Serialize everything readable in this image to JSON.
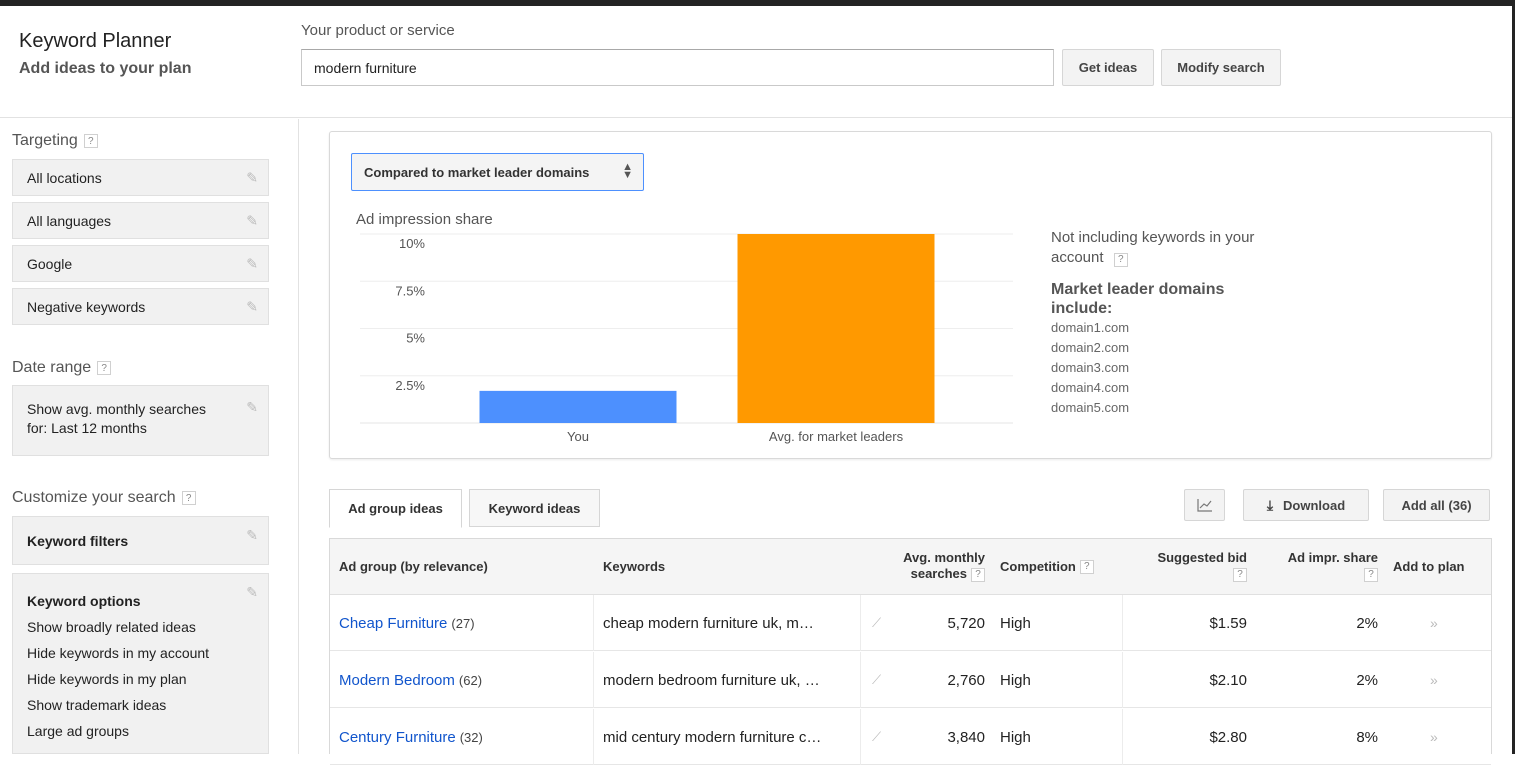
{
  "app": {
    "title": "Keyword Planner",
    "subtitle": "Add ideas to your plan"
  },
  "search": {
    "label": "Your product or service",
    "value": "modern furniture",
    "get_ideas": "Get ideas",
    "modify_search": "Modify search"
  },
  "sidebar": {
    "targeting_label": "Targeting",
    "targeting_items": [
      {
        "label": "All locations"
      },
      {
        "label": "All languages"
      },
      {
        "label": "Google"
      },
      {
        "label": "Negative keywords"
      }
    ],
    "date_range_label": "Date range",
    "date_range_line1": "Show avg. monthly searches",
    "date_range_line2": "for: Last 12 months",
    "customize_label": "Customize your search",
    "keyword_filters": "Keyword filters",
    "keyword_options": {
      "title": "Keyword options",
      "items": [
        "Show broadly related ideas",
        "Hide keywords in my account",
        "Hide keywords in my plan",
        "Show trademark ideas",
        "Large ad groups"
      ]
    }
  },
  "chart_panel": {
    "compare_select": "Compared to market leader domains",
    "note_line1": "Not including keywords in your",
    "note_line2": "account",
    "leaders_heading_line1": "Market leader domains",
    "leaders_heading_line2": "include:",
    "domains": [
      "domain1.com",
      "domain2.com",
      "domain3.com",
      "domain4.com",
      "domain5.com"
    ]
  },
  "chart_data": {
    "type": "bar",
    "title": "Ad impression share",
    "categories": [
      "You",
      "Avg. for market leaders"
    ],
    "values": [
      1.7,
      10
    ],
    "colors": [
      "#4d90fe",
      "#ff9900"
    ],
    "ylim": [
      0,
      10
    ],
    "yticks": [
      2.5,
      5,
      7.5,
      10
    ],
    "ytick_labels": [
      "2.5%",
      "5%",
      "7.5%",
      "10%"
    ],
    "xlabel": "",
    "ylabel": "",
    "grid": true
  },
  "tabs": [
    {
      "label": "Ad group ideas",
      "active": true
    },
    {
      "label": "Keyword ideas",
      "active": false
    }
  ],
  "actions": {
    "chart_icon": "line-chart-icon",
    "download": "Download",
    "add_all": "Add all (36)"
  },
  "table": {
    "headers": {
      "adgroup": "Ad group (by relevance)",
      "keywords": "Keywords",
      "searches_line1": "Avg. monthly",
      "searches_line2": "searches",
      "competition": "Competition",
      "bid": "Suggested bid",
      "impr": "Ad impr. share",
      "add": "Add to plan"
    },
    "rows": [
      {
        "name": "Cheap Furniture",
        "count": "(27)",
        "keywords": "cheap modern furniture uk, m…",
        "searches": "5,720",
        "competition": "High",
        "bid": "$1.59",
        "share": "2%"
      },
      {
        "name": "Modern Bedroom",
        "count": "(62)",
        "keywords": "modern bedroom furniture uk, …",
        "searches": "2,760",
        "competition": "High",
        "bid": "$2.10",
        "share": "2%"
      },
      {
        "name": "Century Furniture",
        "count": "(32)",
        "keywords": "mid century modern furniture c…",
        "searches": "3,840",
        "competition": "High",
        "bid": "$2.80",
        "share": "8%"
      }
    ]
  }
}
